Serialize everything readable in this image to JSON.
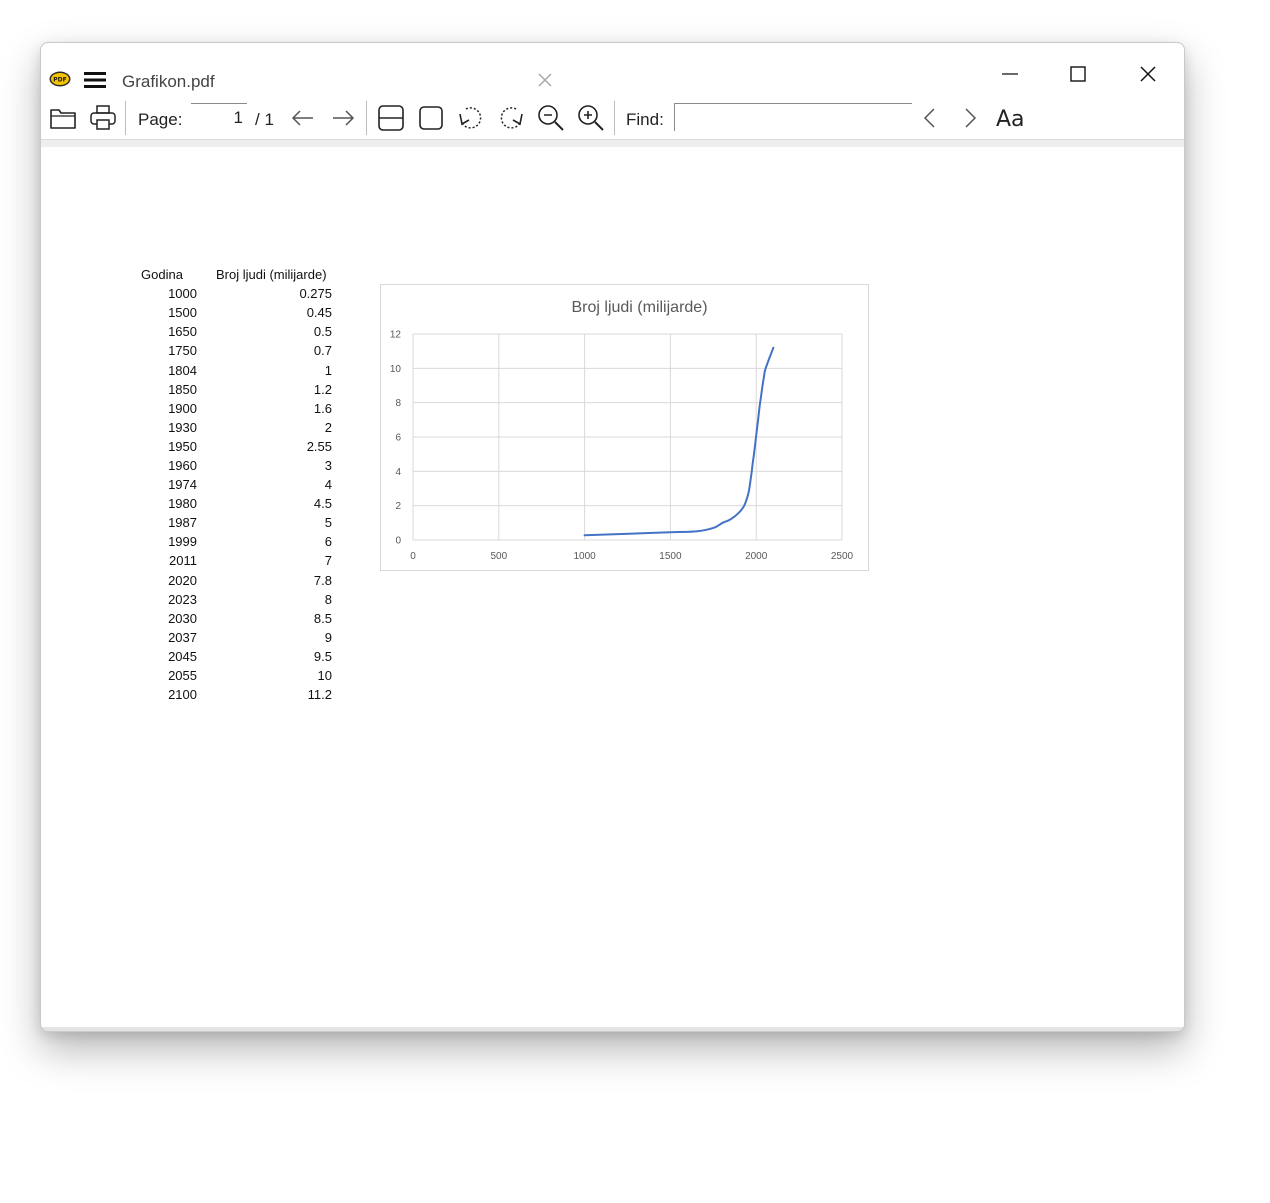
{
  "window": {
    "title": "Grafikon.pdf",
    "app_icon_text": "PDF"
  },
  "toolbar": {
    "page_label": "Page:",
    "page_value": "1",
    "page_total": "/ 1",
    "find_label": "Find:",
    "find_value": "",
    "match_case_label": "Aa"
  },
  "icons": {
    "menu": "hamburger-icon",
    "open": "folder-icon",
    "print": "printer-icon",
    "back": "arrow-left-icon",
    "forward": "arrow-right-icon",
    "fit_width": "fit-width-icon",
    "fit_page": "fit-page-icon",
    "rotate_left": "rotate-left-icon",
    "rotate_right": "rotate-right-icon",
    "zoom_out": "zoom-out-icon",
    "zoom_in": "zoom-in-icon",
    "find_prev": "chevron-left-icon",
    "find_next": "chevron-right-icon"
  },
  "colors": {
    "series_line": "#4472c4",
    "gridline": "#d9d9d9",
    "axis_text": "#595959"
  },
  "table": {
    "headers": [
      "Godina",
      "Broj ljudi (milijarde)"
    ],
    "rows": [
      [
        "1000",
        "0.275"
      ],
      [
        "1500",
        "0.45"
      ],
      [
        "1650",
        "0.5"
      ],
      [
        "1750",
        "0.7"
      ],
      [
        "1804",
        "1"
      ],
      [
        "1850",
        "1.2"
      ],
      [
        "1900",
        "1.6"
      ],
      [
        "1930",
        "2"
      ],
      [
        "1950",
        "2.55"
      ],
      [
        "1960",
        "3"
      ],
      [
        "1974",
        "4"
      ],
      [
        "1980",
        "4.5"
      ],
      [
        "1987",
        "5"
      ],
      [
        "1999",
        "6"
      ],
      [
        "2011",
        "7"
      ],
      [
        "2020",
        "7.8"
      ],
      [
        "2023",
        "8"
      ],
      [
        "2030",
        "8.5"
      ],
      [
        "2037",
        "9"
      ],
      [
        "2045",
        "9.5"
      ],
      [
        "2055",
        "10"
      ],
      [
        "2100",
        "11.2"
      ]
    ]
  },
  "chart_data": {
    "type": "scatter",
    "title": "Broj ljudi (milijarde)",
    "xlabel": "",
    "ylabel": "",
    "xlim": [
      0,
      2500
    ],
    "ylim": [
      0,
      12
    ],
    "x_ticks": [
      "0",
      "500",
      "1000",
      "1500",
      "2000",
      "2500"
    ],
    "y_ticks": [
      "0",
      "2",
      "4",
      "6",
      "8",
      "10",
      "12"
    ],
    "grid": true,
    "legend": "none",
    "series": [
      {
        "x": [
          1000,
          1500,
          1650,
          1750,
          1804,
          1850,
          1900,
          1930,
          1950,
          1960,
          1974,
          1980,
          1987,
          1999,
          2011,
          2020,
          2023,
          2030,
          2037,
          2045,
          2055,
          2100
        ],
        "y": [
          0.275,
          0.45,
          0.5,
          0.7,
          1,
          1.2,
          1.6,
          2,
          2.55,
          3,
          4,
          4.5,
          5,
          6,
          7,
          7.8,
          8,
          8.5,
          9,
          9.5,
          10,
          11.2
        ]
      }
    ]
  }
}
